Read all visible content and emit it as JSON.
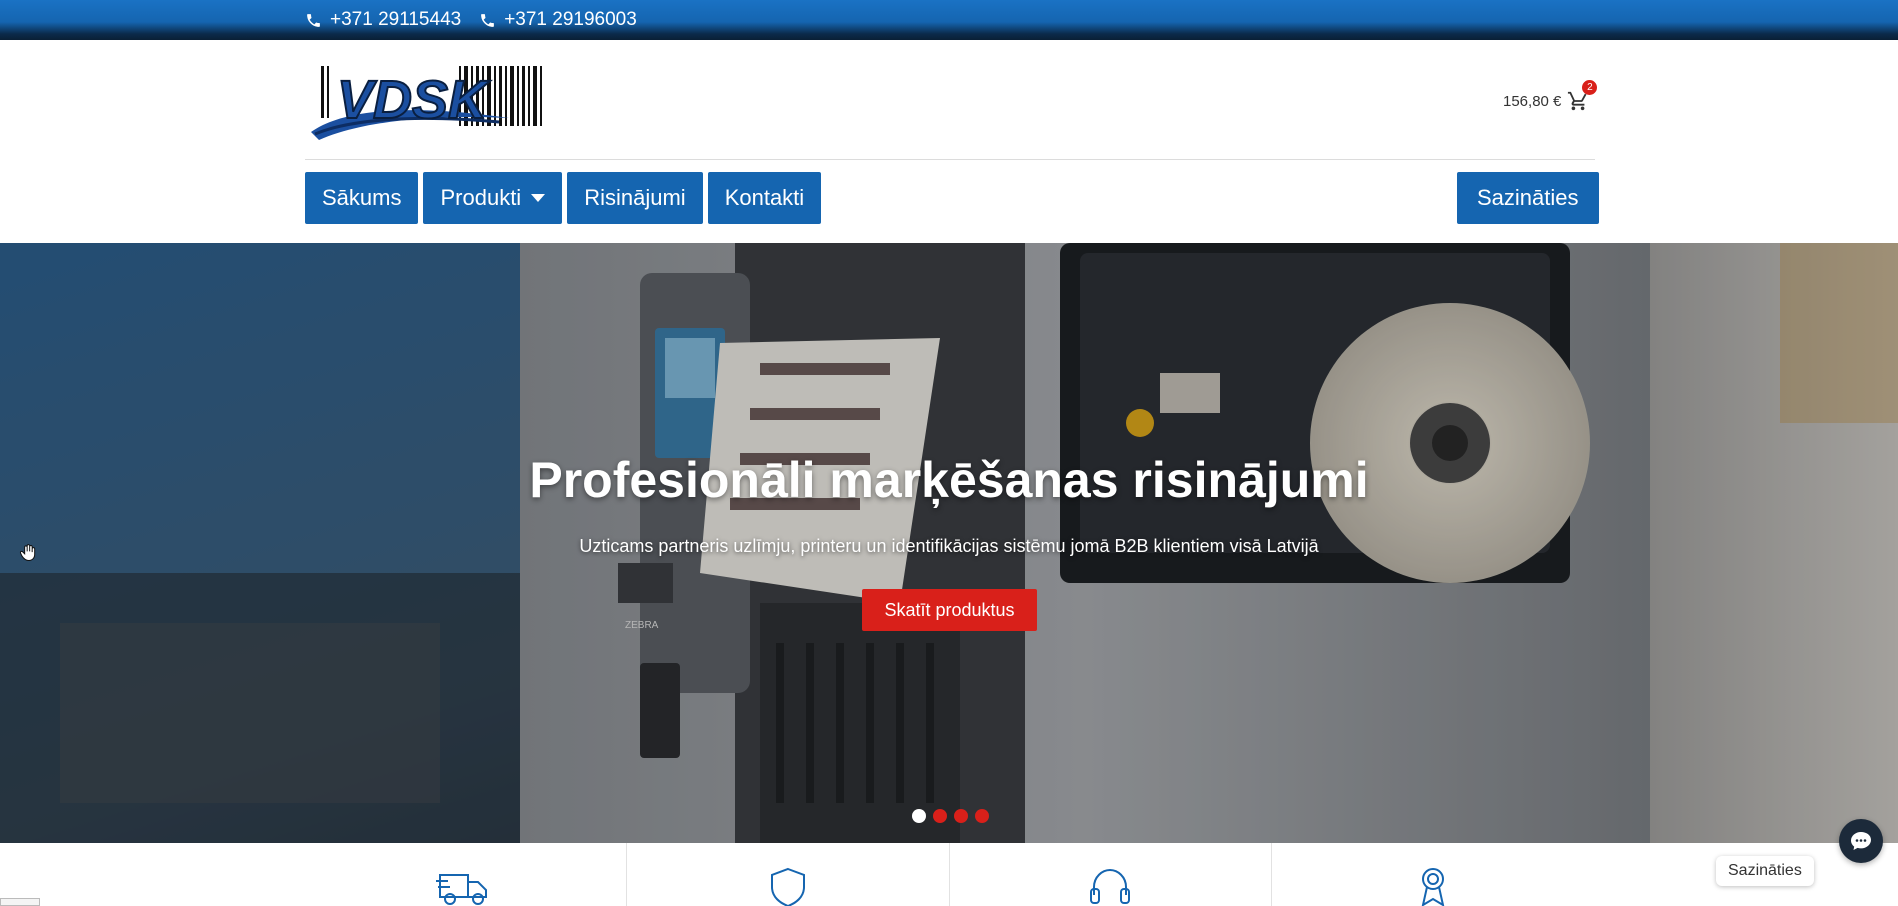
{
  "topbar": {
    "phones": [
      "+371 29115443",
      "+371 29196003"
    ]
  },
  "header": {
    "logo_text": "VDSK",
    "cart": {
      "total": "156,80 €",
      "count": "2"
    }
  },
  "nav": {
    "items": [
      {
        "label": "Sākums"
      },
      {
        "label": "Produkti",
        "has_dropdown": true
      },
      {
        "label": "Risinājumi"
      },
      {
        "label": "Kontakti"
      }
    ],
    "contact_label": "Sazināties"
  },
  "hero": {
    "title": "Profesionāli marķēšanas risinājumi",
    "subtitle": "Uzticams partneris uzlīmju, printeru un identifikācijas sistēmu jomā B2B klientiem visā Latvijā",
    "cta": "Skatīt produktus",
    "slides": 4,
    "active_slide": 1,
    "printer_brand": "ZEBRA"
  },
  "features": {
    "icons": [
      "truck-icon",
      "shield-icon",
      "headset-icon",
      "award-icon"
    ]
  },
  "chat": {
    "label": "Sazināties"
  },
  "colors": {
    "brand_blue": "#1565b0",
    "accent_red": "#d9201a",
    "topbar_dark": "#0a1f35"
  }
}
